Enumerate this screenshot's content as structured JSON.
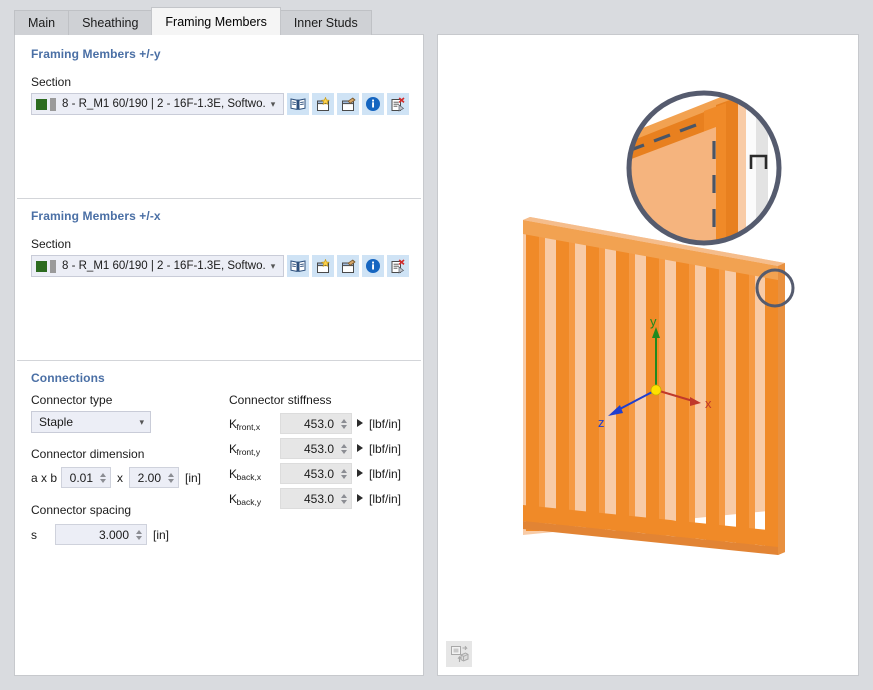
{
  "tabs": [
    {
      "label": "Main",
      "active": false
    },
    {
      "label": "Sheathing",
      "active": false
    },
    {
      "label": "Framing Members",
      "active": true
    },
    {
      "label": "Inner Studs",
      "active": false
    }
  ],
  "groups": {
    "framing_y": {
      "title": "Framing Members +/-y",
      "section_label": "Section",
      "section_value": "8 - R_M1 60/190 | 2 - 16F-1.3E, Softwo...",
      "icons": [
        "library-icon",
        "new-section-icon",
        "edit-section-icon",
        "info-icon",
        "delete-section-icon"
      ]
    },
    "framing_x": {
      "title": "Framing Members +/-x",
      "section_label": "Section",
      "section_value": "8 - R_M1 60/190 | 2 - 16F-1.3E, Softwo...",
      "icons": [
        "library-icon",
        "new-section-icon",
        "edit-section-icon",
        "info-icon",
        "delete-section-icon"
      ]
    },
    "connections": {
      "title": "Connections",
      "connector_type_label": "Connector type",
      "connector_type_value": "Staple",
      "connector_dimension_label": "Connector dimension",
      "dimension_prefix": "a x b",
      "dimension_a": "0.01",
      "dimension_sep": "x",
      "dimension_b": "2.00",
      "dimension_unit": "[in]",
      "connector_spacing_label": "Connector spacing",
      "spacing_symbol": "s",
      "spacing_value": "3.000",
      "spacing_unit": "[in]",
      "stiffness_label": "Connector stiffness",
      "stiffness_rows": [
        {
          "symbol": "K",
          "sub": "front,x",
          "value": "453.0",
          "unit": "[lbf/in]"
        },
        {
          "symbol": "K",
          "sub": "front,y",
          "value": "453.0",
          "unit": "[lbf/in]"
        },
        {
          "symbol": "K",
          "sub": "back,x",
          "value": "453.0",
          "unit": "[lbf/in]"
        },
        {
          "symbol": "K",
          "sub": "back,y",
          "value": "453.0",
          "unit": "[lbf/in]"
        }
      ]
    }
  },
  "viewport": {
    "axes": {
      "x_label": "x",
      "y_label": "y",
      "z_label": "z"
    },
    "axis_colors": {
      "x": "#c0392b",
      "y": "#1f8a1f",
      "z": "#1f3fd0",
      "origin": "#ffe000"
    },
    "render_button_icon": "render-view-icon",
    "detail_callout_symbol": "staple-glyph"
  },
  "colors": {
    "accent_group_title": "#4a6fa5",
    "tab_active_bg": "#f5f5f5",
    "tab_inactive_bg": "#cfd1d5",
    "window_bg": "#d9dbdf",
    "field_bg": "#eceef6",
    "field_bg_gray": "#e6e6e6",
    "icon_button_bg": "#cfe3f5",
    "section_swatch": "#2c6b1f",
    "wood_dark": "#f08a28",
    "wood_mid": "#f59a44",
    "wood_light": "#f8cba6",
    "wood_top": "#f5b47e",
    "callout_ring": "#555b6e"
  }
}
